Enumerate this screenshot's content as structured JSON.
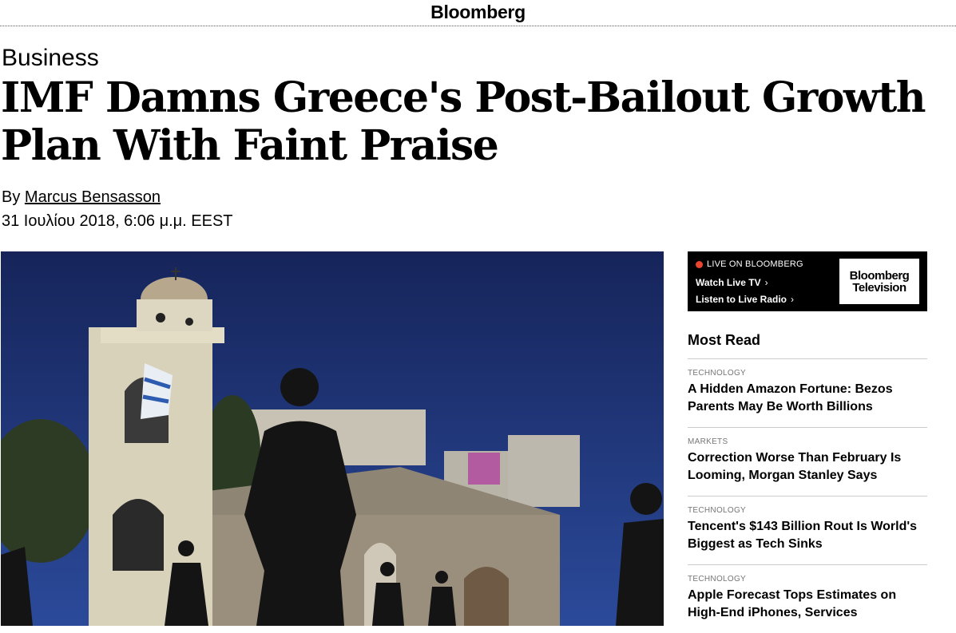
{
  "header": {
    "logo_text": "Bloomberg"
  },
  "article": {
    "section": "Business",
    "headline": "IMF Damns Greece's Post-Bailout Growth Plan With Faint Praise",
    "byline_prefix": "By",
    "author": "Marcus Bensasson",
    "date": "31 Ιουλίου 2018, 6:06 μ.μ. EEST"
  },
  "live_box": {
    "live_label": "LIVE ON BLOOMBERG",
    "watch_label": "Watch Live TV",
    "listen_label": "Listen to Live Radio",
    "logo_line1": "Bloomberg",
    "logo_line2": "Television",
    "live_dot_color": "#e8442e"
  },
  "most_read": {
    "title": "Most Read",
    "items": [
      {
        "category": "TECHNOLOGY",
        "title": "A Hidden Amazon Fortune: Bezos Parents May Be Worth Billions"
      },
      {
        "category": "MARKETS",
        "title": "Correction Worse Than February Is Looming, Morgan Stanley Says"
      },
      {
        "category": "TECHNOLOGY",
        "title": "Tencent's $143 Billion Rout Is World's Biggest as Tech Sinks"
      },
      {
        "category": "TECHNOLOGY",
        "title": "Apple Forecast Tops Estimates on High-End iPhones, Services"
      }
    ]
  },
  "icons": {
    "chevron": "chevron-right-icon"
  }
}
